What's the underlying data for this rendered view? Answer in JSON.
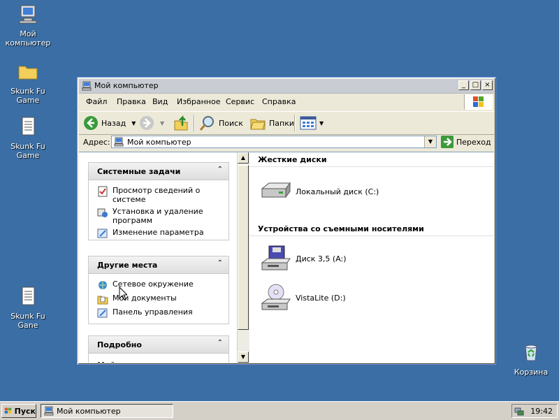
{
  "desktop": {
    "icons": [
      {
        "label": "Мой\nкомпьютер",
        "icon": "my-computer-icon"
      },
      {
        "label": "Skunk Fu Game",
        "icon": "folder-icon"
      },
      {
        "label": "Skunk Fu Game",
        "icon": "text-document-icon"
      },
      {
        "label": "Skunk Fu Gane",
        "icon": "text-document-icon"
      },
      {
        "label": "Корзина",
        "icon": "recycle-bin-icon"
      }
    ]
  },
  "window": {
    "title": "Мой компьютер",
    "menu": [
      "Файл",
      "Правка",
      "Вид",
      "Избранное",
      "Сервис",
      "Справка"
    ],
    "toolbar": {
      "back": "Назад",
      "search": "Поиск",
      "folders": "Папки"
    },
    "address": {
      "label": "Адрес:",
      "value": "Мой компьютер",
      "go": "Переход"
    },
    "tasks_panel": {
      "title": "Системные задачи",
      "items": [
        "Просмотр сведений о системе",
        "Установка и удаление программ",
        "Изменение параметра"
      ]
    },
    "places_panel": {
      "title": "Другие места",
      "items": [
        "Сетевое окружение",
        "Мои документы",
        "Панель управления"
      ]
    },
    "details_panel": {
      "title": "Подробно",
      "text": "Мой компьютер"
    },
    "groups": [
      {
        "title": "Жесткие диски",
        "items": [
          "Локальный диск (C:)"
        ]
      },
      {
        "title": "Устройства со съемными носителями",
        "items": [
          "Диск 3,5 (A:)",
          "VistaLite (D:)"
        ]
      }
    ]
  },
  "taskbar": {
    "start": "Пуск",
    "task": "Мой компьютер",
    "clock": "19:42"
  }
}
